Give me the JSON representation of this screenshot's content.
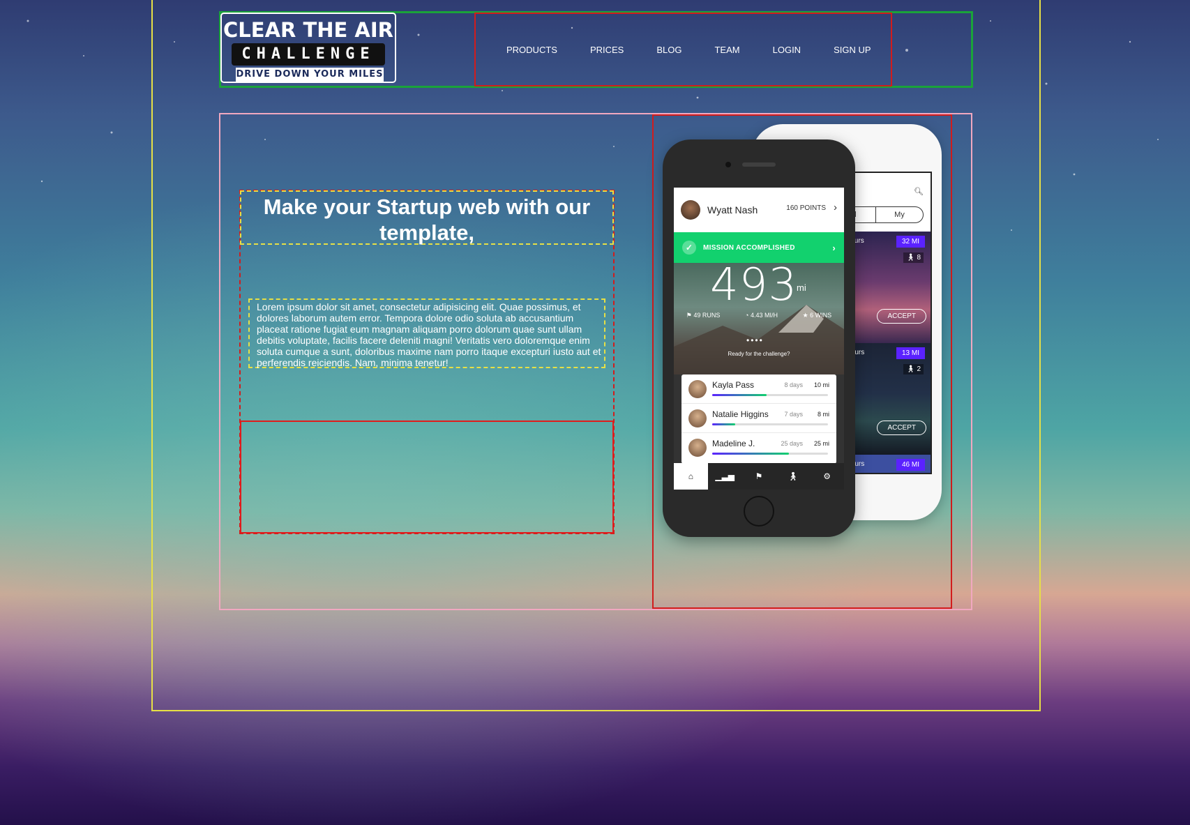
{
  "logo": {
    "title": "CLEAR THE AIR",
    "subtitle": "CHALLENGE",
    "tagline": "DRIVE DOWN YOUR MILES"
  },
  "nav": {
    "items": [
      {
        "label": "PRODUCTS"
      },
      {
        "label": "PRICES"
      },
      {
        "label": "BLOG"
      },
      {
        "label": "TEAM"
      },
      {
        "label": "LOGIN"
      },
      {
        "label": "SIGN UP"
      }
    ]
  },
  "hero": {
    "headline": "Make your Startup web with our template,",
    "paragraph": "Lorem ipsum dolor sit amet, consectetur adipisicing elit. Quae possimus, et dolores laborum autem error. Tempora dolore odio soluta ab accusantium placeat ratione fugiat eum magnam aliquam porro dolorum quae sunt ullam debitis voluptate, facilis facere deleniti magni! Veritatis vero doloremque enim soluta cumque a sunt, doloribus maxime nam porro itaque excepturi iusto aut et perferendis reiciendis. Nam, minima tenetur!"
  },
  "phone_front": {
    "user_name": "Wyatt Nash",
    "points": "160 POINTS",
    "mission": "MISSION ACCOMPLISHED",
    "big_number": "493",
    "unit": "mi",
    "stats": {
      "runs": "49 RUNS",
      "speed": "4.43 MI/H",
      "wins": "6 WINS"
    },
    "ready": "Ready for the challenge?",
    "leaderboard": [
      {
        "name": "Kayla Pass",
        "days": "8 days",
        "miles": "10 mi",
        "progress": 0.47
      },
      {
        "name": "Natalie Higgins",
        "days": "7 days",
        "miles": "8 mi",
        "progress": 0.2
      },
      {
        "name": "Madeline J.",
        "days": "25 days",
        "miles": "25 mi",
        "progress": 0.66
      }
    ]
  },
  "phone_back": {
    "search_fragment": "s",
    "tabs": [
      "ed",
      "My"
    ],
    "cards": [
      {
        "hours": "ys 12 hours",
        "miles": "32 MI",
        "count": "8",
        "action": "ACCEPT"
      },
      {
        "hours": "ay 12 hours",
        "miles": "13 MI",
        "count": "2",
        "action": "ACCEPT"
      },
      {
        "hours": "ay 12 hours",
        "miles": "46 MI"
      }
    ]
  },
  "colors": {
    "nav_outline": "#1aa33a",
    "menu_outline": "#d21c1c",
    "frame_outline": "#e7e045",
    "hero_outline": "#f1a8c0",
    "mission_green": "#12d16e",
    "pill_purple": "#5b22ff"
  }
}
